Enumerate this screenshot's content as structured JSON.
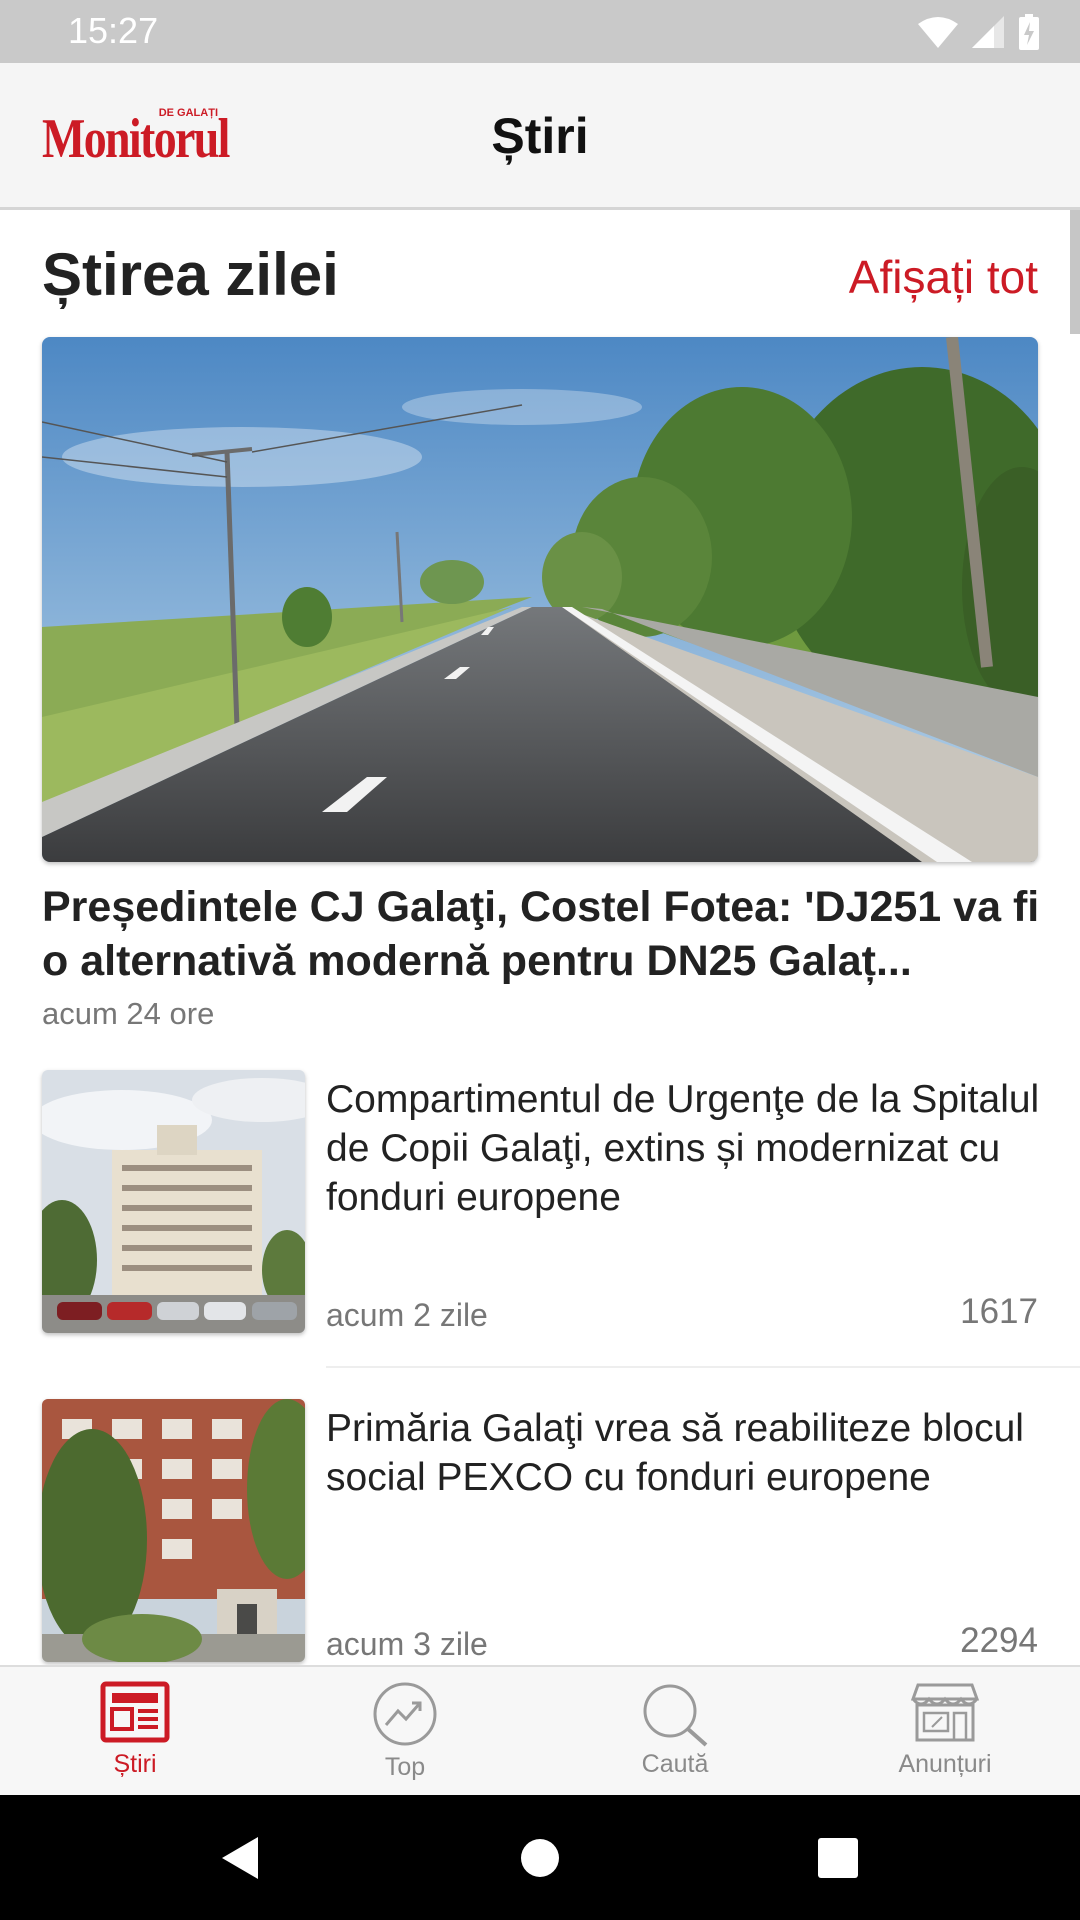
{
  "status_bar": {
    "time": "15:27"
  },
  "app_bar": {
    "logo_main": "Monitorul",
    "logo_small": "DE GALAȚI",
    "title": "Știri"
  },
  "section": {
    "title": "Știrea zilei",
    "show_all": "Afișați tot"
  },
  "hero": {
    "title": "Președintele CJ Galaţi, Costel Fotea: 'DJ251 va fi o alternativă modernă pentru DN25 Galaț...",
    "time": "acum 24 ore"
  },
  "articles": [
    {
      "title": "Compartimentul de Urgenţe de la Spitalul de Copii Galaţi, extins și modernizat cu fonduri europene",
      "time": "acum 2 zile",
      "views": "1617"
    },
    {
      "title": "Primăria Galaţi vrea să reabiliteze blocul social PEXCO cu fonduri europene",
      "time": "acum 3 zile",
      "views": "2294"
    }
  ],
  "bottom_nav": [
    {
      "label": "Știri",
      "icon": "newspaper-icon",
      "active": true
    },
    {
      "label": "Top",
      "icon": "trending-icon",
      "active": false
    },
    {
      "label": "Caută",
      "icon": "search-icon",
      "active": false
    },
    {
      "label": "Anunțuri",
      "icon": "store-icon",
      "active": false
    }
  ],
  "colors": {
    "accent": "#cc1b25",
    "muted": "#8a8a8a"
  }
}
